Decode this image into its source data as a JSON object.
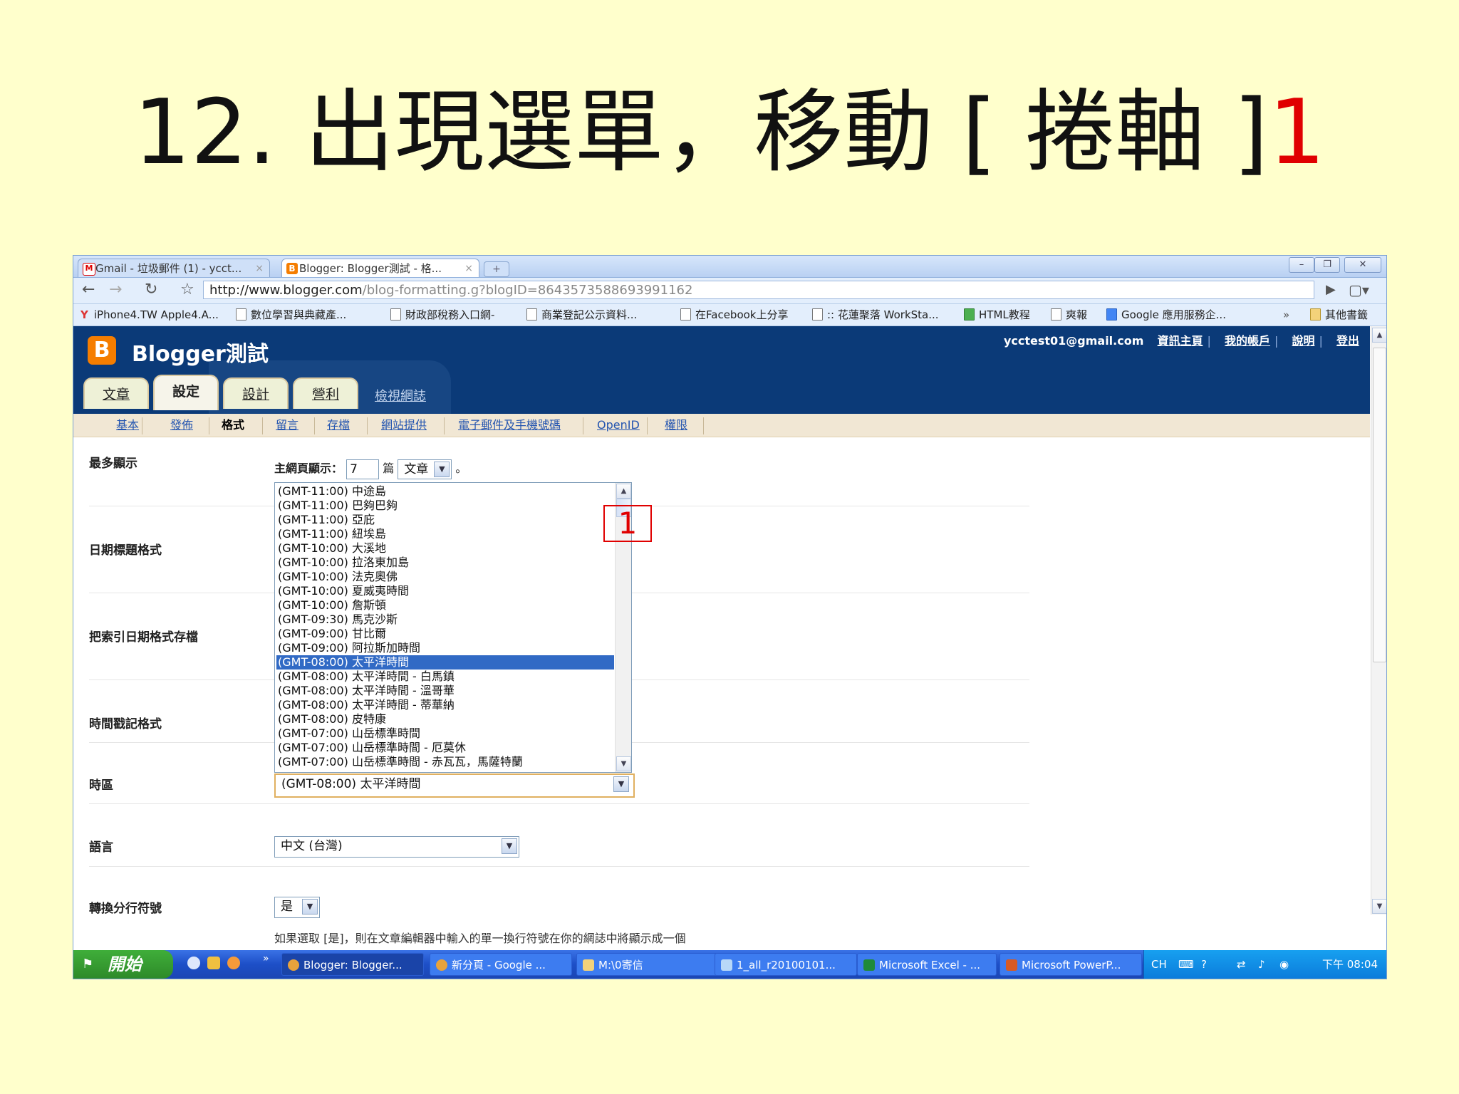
{
  "slide": {
    "title_main": "12. 出現選單，移動 [ 捲軸 ]",
    "title_highlight": "1"
  },
  "browser": {
    "tabs": [
      {
        "label": "Gmail - 垃圾郵件 (1) - ycct...",
        "icon": "gmail-icon"
      },
      {
        "label": "Blogger: Blogger測試 - 格...",
        "icon": "blogger-icon"
      }
    ],
    "url_host": "http://www.blogger.com",
    "url_path": "/blog-formatting.g?blogID=8643573588693991162",
    "bookmarks": [
      "iPhone4.TW Apple4.A...",
      "數位學習與典藏產...",
      "財政部稅務入口網-",
      "商業登記公示資料...",
      "在Facebook上分享",
      ":: 花蓮聚落 WorkSta...",
      "HTML教程",
      "爽報",
      "Google 應用服務企...",
      "其他書籤"
    ]
  },
  "blogger": {
    "blog_name": "Blogger測試",
    "user_email": "ycctest01@gmail.com",
    "user_links": [
      "資訊主頁",
      "我的帳戶",
      "說明",
      "登出"
    ],
    "tabs": [
      "文章",
      "設定",
      "設計",
      "營利"
    ],
    "view_blog": "檢視網誌",
    "subnav": [
      "基本",
      "發佈",
      "格式",
      "留言",
      "存檔",
      "網站提供",
      "電子郵件及手機號碼",
      "OpenID",
      "權限"
    ]
  },
  "settings": {
    "labels": [
      "最多顯示",
      "日期標題格式",
      "把索引日期格式存檔",
      "時間戳記格式",
      "時區",
      "語言",
      "轉換分行符號"
    ],
    "posts_prefix": "主網頁顯示：",
    "posts_count": "7",
    "posts_unit": "篇",
    "posts_type": "文章",
    "posts_suffix": "。",
    "timezone_options": [
      "(GMT-11:00) 中途島",
      "(GMT-11:00) 巴夠巴夠",
      "(GMT-11:00) 亞庇",
      "(GMT-11:00) 紐埃島",
      "(GMT-10:00) 大溪地",
      "(GMT-10:00) 拉洛東加島",
      "(GMT-10:00) 法克奧佛",
      "(GMT-10:00) 夏威夷時間",
      "(GMT-10:00) 詹斯頓",
      "(GMT-09:30) 馬克沙斯",
      "(GMT-09:00) 甘比爾",
      "(GMT-09:00) 阿拉斯加時間",
      "(GMT-08:00) 太平洋時間",
      "(GMT-08:00) 太平洋時間 - 白馬鎮",
      "(GMT-08:00) 太平洋時間 - 溫哥華",
      "(GMT-08:00) 太平洋時間 - 蒂華納",
      "(GMT-08:00) 皮特康",
      "(GMT-07:00) 山岳標準時間",
      "(GMT-07:00) 山岳標準時間 - 厄莫休",
      "(GMT-07:00) 山岳標準時間 - 赤瓦瓦，馬薩特蘭"
    ],
    "timezone_selected_index": 12,
    "timezone_value": "(GMT-08:00) 太平洋時間",
    "language_value": "中文 (台灣)",
    "linebreak_value": "是",
    "help_text": "如果選取 [是]，則在文章編輯器中輸入的單一換行符號在你的網誌中將顯示成一個"
  },
  "annotation": {
    "marker_label": "1",
    "color": "#e00000"
  },
  "taskbar": {
    "start_label": "開始",
    "tasks": [
      "Blogger: Blogger...",
      "新分頁 - Google ...",
      "M:\\0寄信",
      "1_all_r20100101...",
      "Microsoft Excel - ...",
      "Microsoft PowerP..."
    ],
    "lang": "CH",
    "clock": "下午 08:04"
  }
}
